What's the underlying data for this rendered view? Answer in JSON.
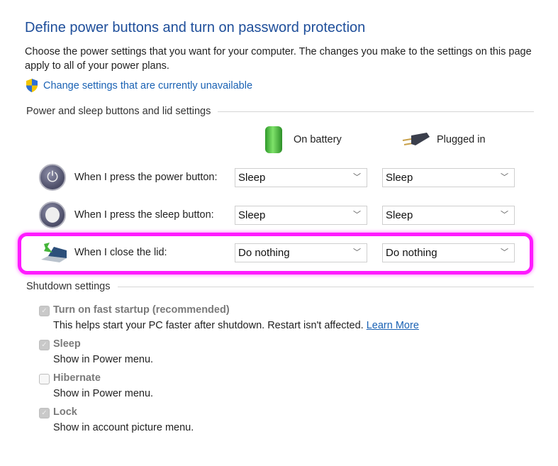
{
  "header": {
    "title": "Define power buttons and turn on password protection",
    "description": "Choose the power settings that you want for your computer. The changes you make to the settings on this page apply to all of your power plans.",
    "change_settings_link": "Change settings that are currently unavailable"
  },
  "power_section": {
    "heading": "Power and sleep buttons and lid settings",
    "columns": {
      "battery": "On battery",
      "plugged": "Plugged in"
    },
    "rows": [
      {
        "label": "When I press the power button:",
        "battery": "Sleep",
        "plugged": "Sleep",
        "icon": "power-button-icon"
      },
      {
        "label": "When I press the sleep button:",
        "battery": "Sleep",
        "plugged": "Sleep",
        "icon": "sleep-button-icon"
      },
      {
        "label": "When I close the lid:",
        "battery": "Do nothing",
        "plugged": "Do nothing",
        "icon": "laptop-lid-icon",
        "highlighted": true
      }
    ],
    "highlight_color": "#ff1aff"
  },
  "shutdown_section": {
    "heading": "Shutdown settings",
    "items": [
      {
        "label": "Turn on fast startup (recommended)",
        "description": "This helps start your PC faster after shutdown. Restart isn't affected.",
        "link": "Learn More",
        "checked": true
      },
      {
        "label": "Sleep",
        "description": "Show in Power menu.",
        "checked": true
      },
      {
        "label": "Hibernate",
        "description": "Show in Power menu.",
        "checked": false
      },
      {
        "label": "Lock",
        "description": "Show in account picture menu.",
        "checked": true
      }
    ]
  }
}
